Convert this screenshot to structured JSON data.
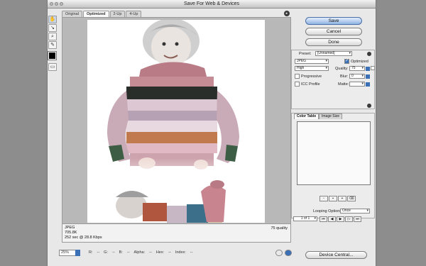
{
  "window": {
    "title": "Save For Web & Devices"
  },
  "tabs": [
    "Original",
    "Optimized",
    "2-Up",
    "4-Up"
  ],
  "tools": {
    "items": [
      "hand-tool",
      "slice-select-tool",
      "zoom-tool",
      "eyedropper-tool"
    ]
  },
  "colors": {
    "eyedropper_swatch": "#000000",
    "accent": "#3b6fb6"
  },
  "buttons": {
    "save": "Save",
    "cancel": "Cancel",
    "done": "Done",
    "device_central": "Device Central..."
  },
  "settings": {
    "preset_label": "Preset:",
    "preset_value": "[Unnamed]",
    "format": "JPEG",
    "quality_level": "High",
    "optimized_label": "Optimized",
    "optimized_checked": true,
    "quality_label": "Quality:",
    "quality_value": "75",
    "progressive_label": "Progressive",
    "blur_label": "Blur:",
    "blur_value": "0",
    "icc_label": "ICC Profile",
    "matte_label": "Matte:"
  },
  "color_panel": {
    "tabs": [
      "Color Table",
      "Image Size"
    ]
  },
  "animation": {
    "looping_label": "Looping Options:",
    "looping_value": "Once",
    "frame": "1 of 1"
  },
  "info": {
    "format": "JPEG",
    "size": "705.8K",
    "time": "252 sec @ 28.8 Kbps",
    "quality": "75 quality"
  },
  "status": {
    "zoom": "25%",
    "r_label": "R:",
    "r_val": "--",
    "g_label": "G:",
    "g_val": "--",
    "b_label": "B:",
    "b_val": "--",
    "alpha_label": "Alpha:",
    "alpha_val": "--",
    "hex_label": "Hex:",
    "hex_val": "--",
    "index_label": "Index:",
    "index_val": "--"
  }
}
